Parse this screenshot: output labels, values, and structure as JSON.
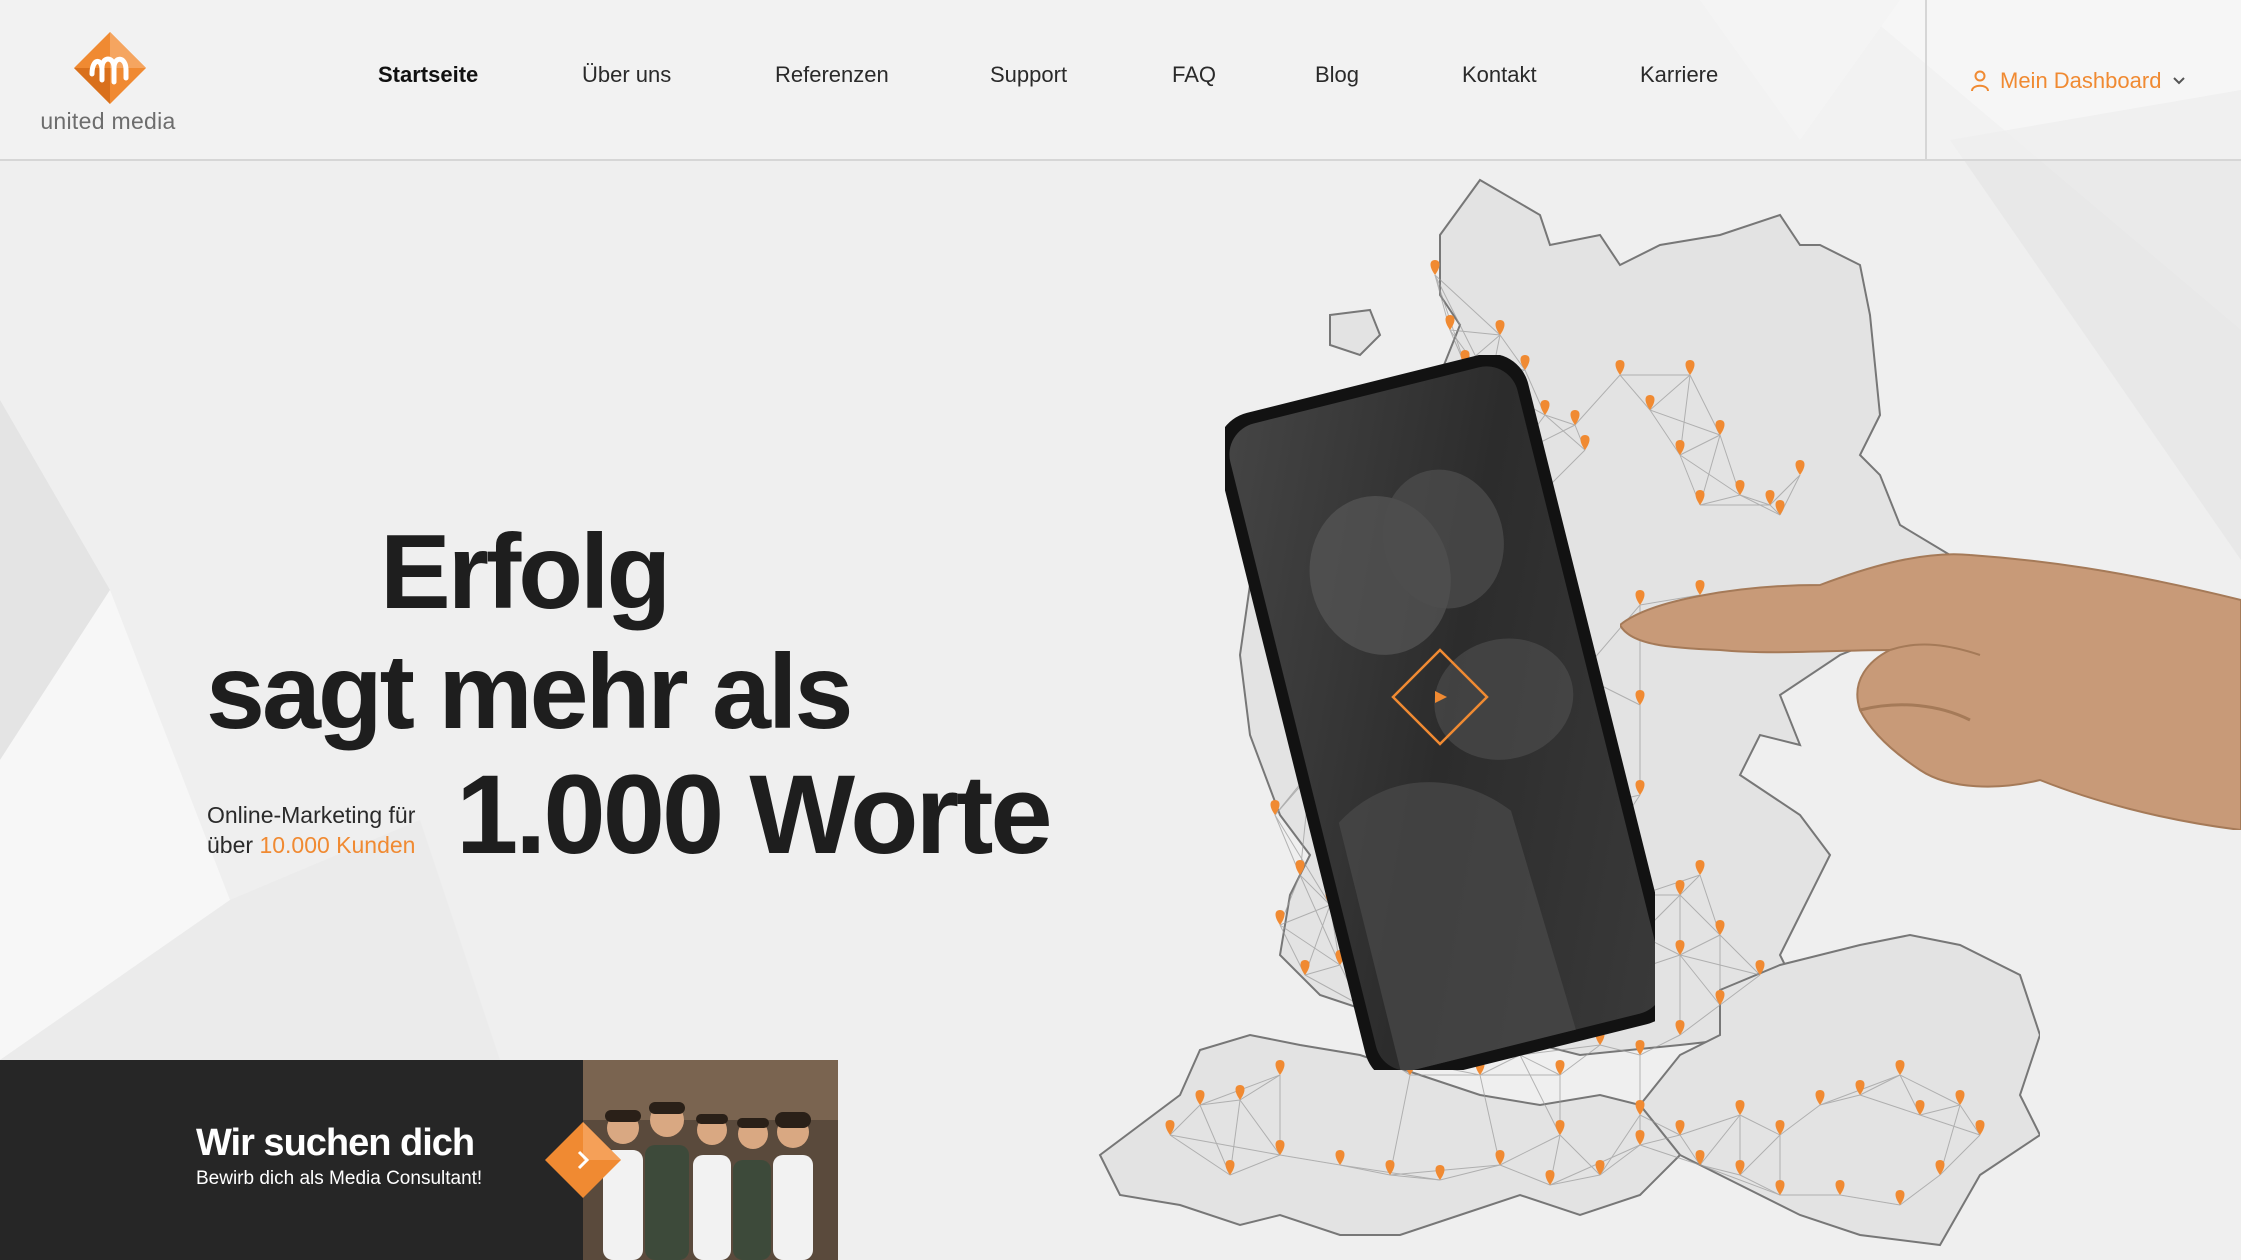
{
  "header": {
    "logo_text": "united media",
    "nav": [
      {
        "label": "Startseite",
        "active": true
      },
      {
        "label": "Über uns",
        "active": false
      },
      {
        "label": "Referenzen",
        "active": false
      },
      {
        "label": "Support",
        "active": false
      },
      {
        "label": "FAQ",
        "active": false
      },
      {
        "label": "Blog",
        "active": false
      },
      {
        "label": "Kontakt",
        "active": false
      },
      {
        "label": "Karriere",
        "active": false
      }
    ],
    "dashboard_label": "Mein Dashboard",
    "dashboard_icon": "user-icon",
    "dropdown_icon": "chevron-down-icon"
  },
  "hero": {
    "line1": "Erfolg",
    "line2": "sagt mehr als",
    "line3": "1.000 Worte",
    "sub_line1": "Online-Marketing für",
    "sub_prefix": "über ",
    "sub_accent": "10.000 Kunden",
    "play_icon": "play-icon"
  },
  "career": {
    "title": "Wir suchen dich",
    "subtitle": "Bewirb dich als Media Consultant!",
    "arrow_icon": "chevron-right-icon"
  },
  "colors": {
    "accent": "#f08a32",
    "dark": "#262626",
    "background": "#efefef"
  }
}
